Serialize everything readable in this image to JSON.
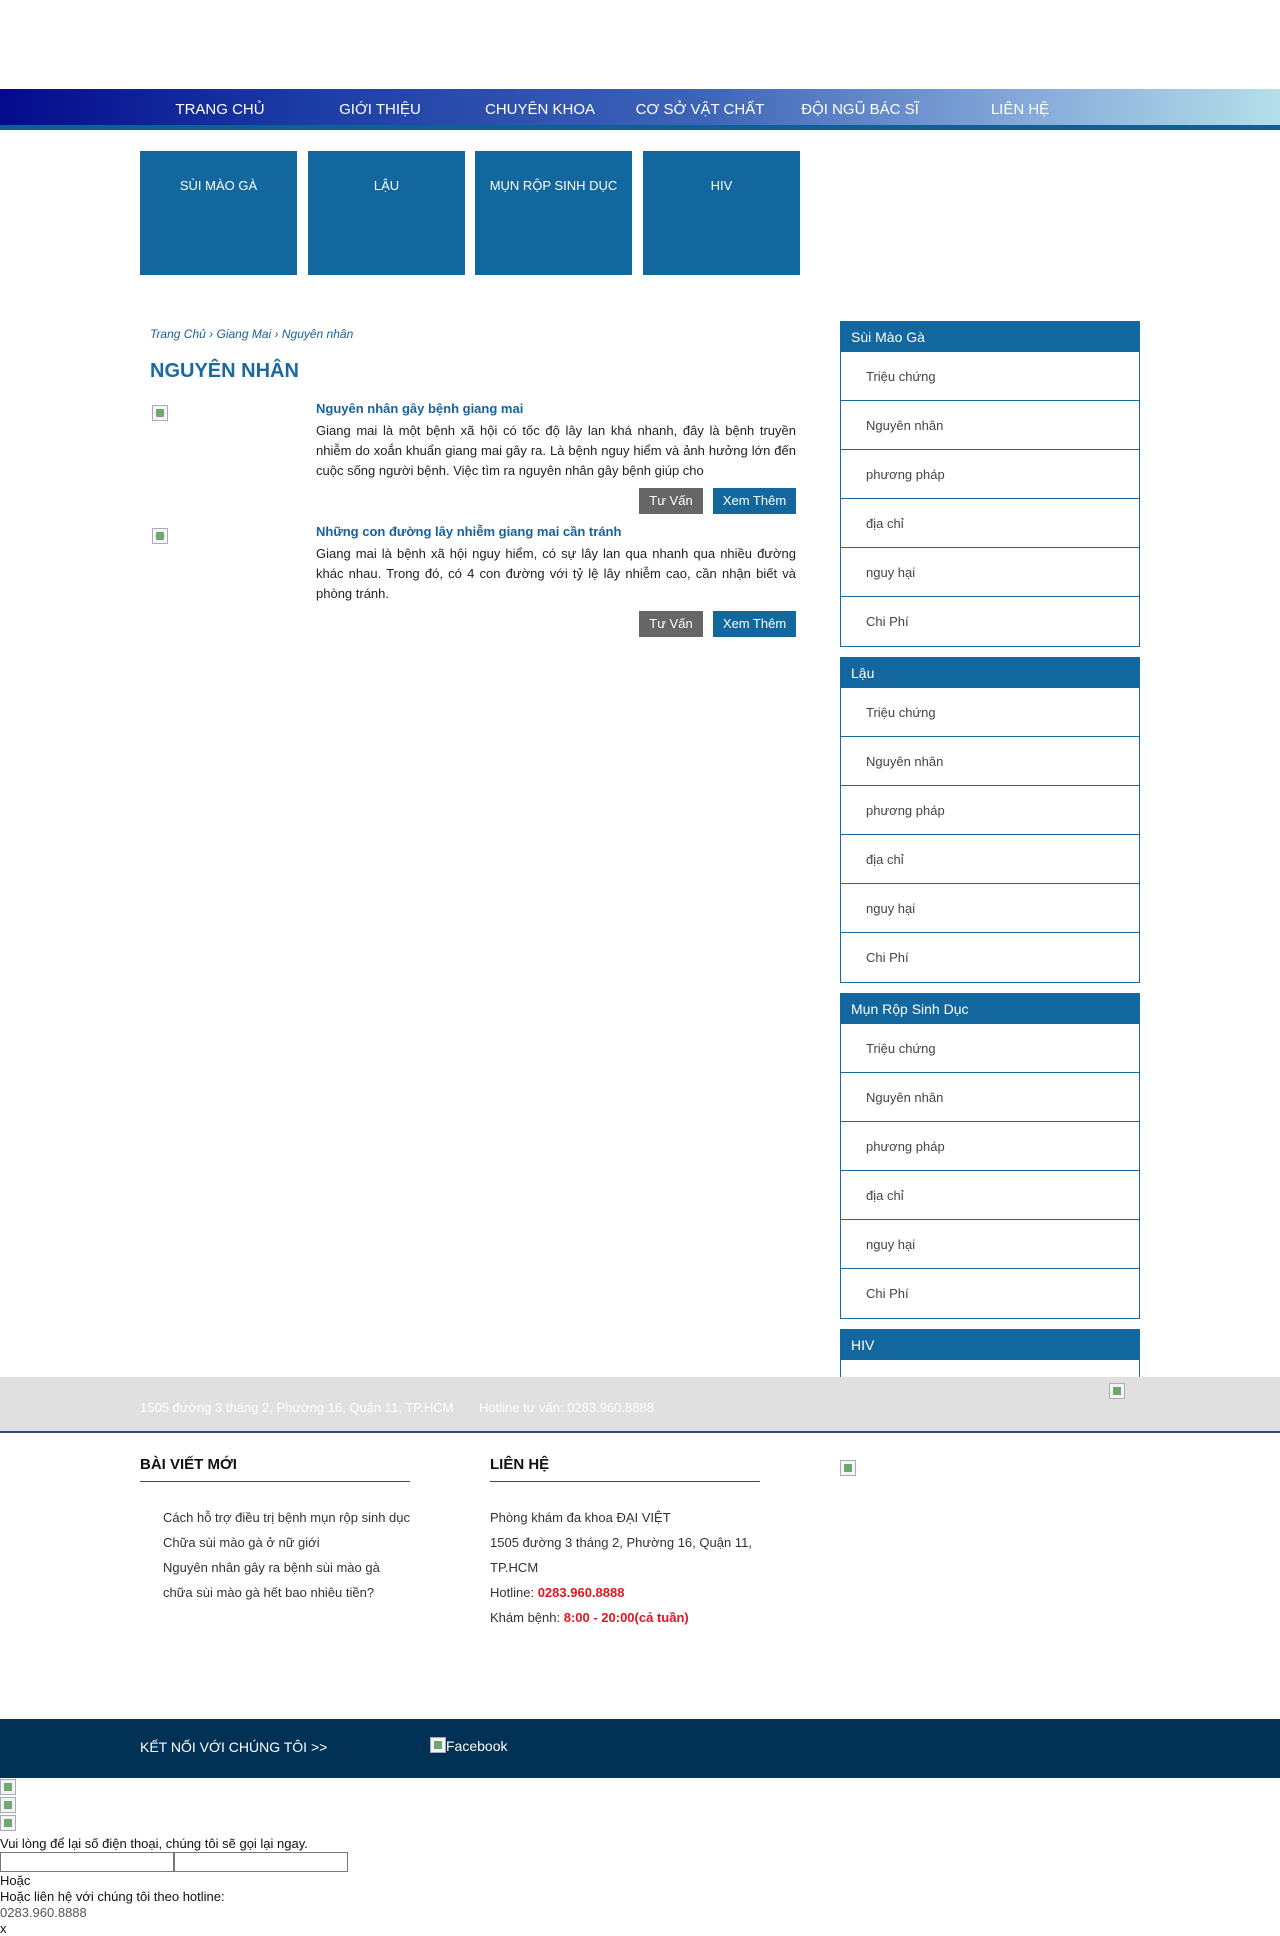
{
  "nav": {
    "items": [
      "TRANG CHỦ",
      "GIỚI THIỆU",
      "CHUYÊN KHOA",
      "CƠ SỞ VẬT CHẤT",
      "ĐỘI NGŨ BÁC SĨ",
      "LIÊN HỆ"
    ]
  },
  "tiles": [
    "SÙI MÀO GÀ",
    "LẬU",
    "MỤN RỘP SINH DỤC",
    "HIV"
  ],
  "breadcrumb": {
    "home": "Trang Chủ",
    "sep1": " › ",
    "cat": "Giang Mai",
    "sep2": " › ",
    "current": "Nguyên nhân"
  },
  "page_title": "NGUYÊN NHÂN",
  "articles": [
    {
      "title": "Nguyên nhân gây bệnh giang mai",
      "excerpt": "Giang mai là một bệnh xã hội có tốc độ lây lan khá nhanh, đây là bệnh truyền nhiễm do xoắn khuẩn giang mai gây ra. Là bệnh nguy hiểm và ảnh hưởng lớn đến cuộc sống người bệnh. Việc tìm ra nguyên nhân gây bệnh giúp cho",
      "consult": "Tư Vấn",
      "more": "Xem Thêm"
    },
    {
      "title": "Những con đường lây nhiễm giang mai cần tránh",
      "excerpt": "Giang mai là bệnh xã hội nguy hiểm, có sự lây lan qua nhanh qua nhiều đường khác nhau. Trong đó, có 4 con đường với tỷ lệ lây nhiễm cao, cần nhận biết và phòng tránh.",
      "consult": "Tư Vấn",
      "more": "Xem Thêm"
    }
  ],
  "sidebar": [
    {
      "title": "Sùi Mào Gà",
      "items": [
        "Triệu chứng",
        "Nguyên nhân",
        "phương pháp",
        "địa chỉ",
        "nguy hại",
        "Chi Phí"
      ]
    },
    {
      "title": "Lậu",
      "items": [
        "Triệu chứng",
        "Nguyên nhân",
        "phương pháp",
        "địa chỉ",
        "nguy hại",
        "Chi Phí"
      ]
    },
    {
      "title": "Mụn Rộp Sinh Dục",
      "items": [
        "Triệu chứng",
        "Nguyên nhân",
        "phương pháp",
        "địa chỉ",
        "nguy hại",
        "Chi Phí"
      ]
    },
    {
      "title": "HIV",
      "items": []
    }
  ],
  "addrbar": {
    "address": "1505 đường 3 tháng 2, Phường 16, Quận 11, TP.HCM",
    "hotline": "Hotline tư vấn: 0283.960.8888"
  },
  "footer": {
    "news_title": "BÀI VIẾT MỚI",
    "news": [
      "Cách hỗ trợ điều trị bệnh mụn rộp sinh dục",
      "Chữa sùi mào gà ở nữ giới",
      "Nguyên nhân gây ra bệnh sùi mào gà",
      "chữa sùi mào gà hết bao nhiêu tiền?"
    ],
    "contact_title": "LIÊN HỆ",
    "clinic": "Phòng khám đa khoa ĐẠI VIỆT",
    "address": "1505 đường 3 tháng 2, Phường 16, Quận 11, TP.HCM",
    "hotline_label": "Hotline: ",
    "hotline_value": "0283.960.8888",
    "hours_label": "Khám bệnh: ",
    "hours_value": "8:00 - 20:00(cả tuần)"
  },
  "connect": {
    "label": "KẾT NỐI VỚI CHÚNG TÔI >>",
    "facebook_alt": "Facebook"
  },
  "callback": {
    "prompt": "Vui lòng để lại số điện thoại, chúng tôi sẽ gọi lại ngay.",
    "or": "Hoặc",
    "hotline_prompt": "Hoặc liên hệ với chúng tôi theo hotline:",
    "hotline": "0283.960.8888",
    "close": "x"
  }
}
